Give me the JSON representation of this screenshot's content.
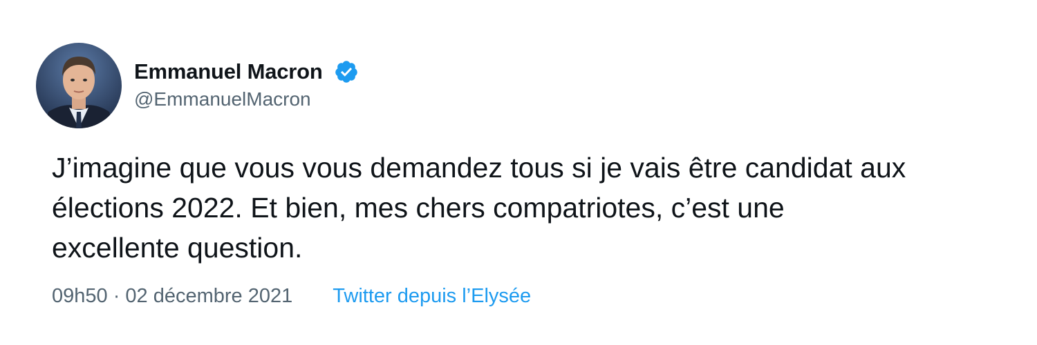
{
  "author": {
    "display_name": "Emmanuel Macron",
    "handle": "@EmmanuelMacron",
    "verified": true,
    "verified_icon": "verified-badge-icon",
    "verified_color": "#1d9bf0"
  },
  "tweet": {
    "text": "J’imagine que vous vous demandez tous si je vais être candidat aux\nélections 2022. Et bien, mes chers compatriotes, c’est une\nexcellente question."
  },
  "meta": {
    "timestamp": "09h50 · 02 décembre 2021",
    "source": "Twitter depuis l’Elysée"
  },
  "colors": {
    "text_primary": "#0f1419",
    "text_secondary": "#536471",
    "accent": "#1d9bf0"
  }
}
